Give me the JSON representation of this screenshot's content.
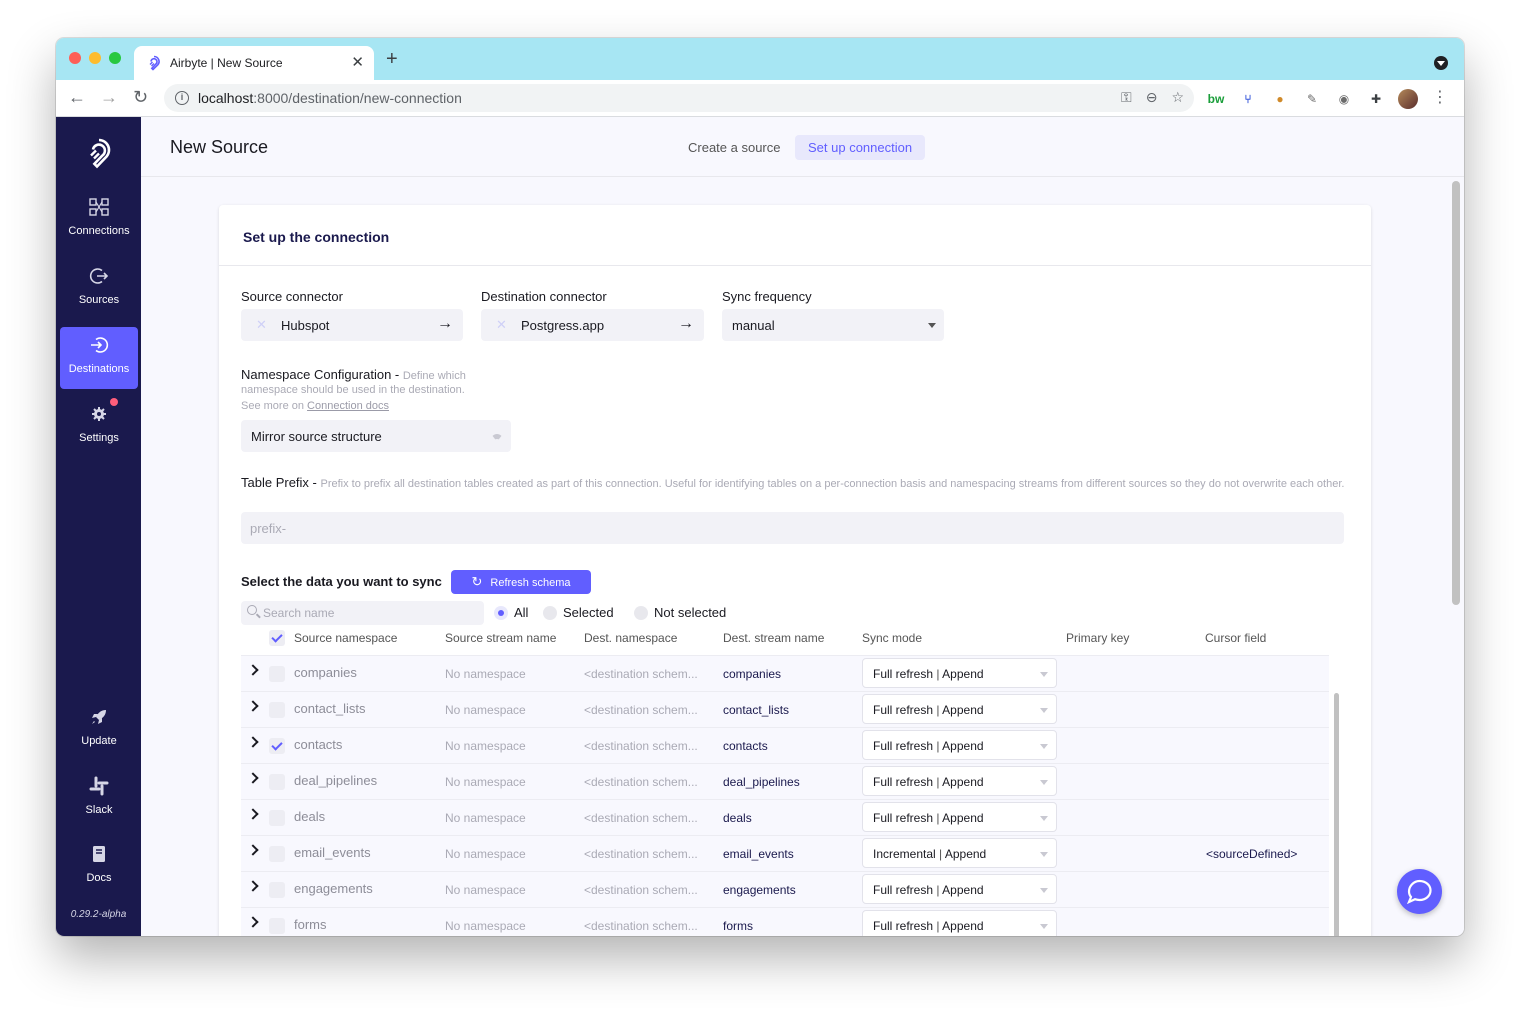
{
  "browser": {
    "tab_title": "Airbyte | New Source",
    "tab_close": "✕",
    "new_tab": "+",
    "url_host": "localhost",
    "url_path": ":8000/destination/new-connection",
    "ext_bw": "bw"
  },
  "sidebar": {
    "items": [
      {
        "label": "Connections",
        "icon": "connections-icon"
      },
      {
        "label": "Sources",
        "icon": "sources-icon"
      },
      {
        "label": "Destinations",
        "icon": "destinations-icon",
        "active": true
      },
      {
        "label": "Settings",
        "icon": "gear-icon"
      },
      {
        "label": "Update",
        "icon": "rocket-icon"
      },
      {
        "label": "Slack",
        "icon": "slack-icon"
      },
      {
        "label": "Docs",
        "icon": "book-icon"
      }
    ],
    "version": "0.29.2-alpha"
  },
  "header": {
    "title": "New Source",
    "steps": [
      "Create a source",
      "Set up connection"
    ],
    "active_step": 1
  },
  "card": {
    "title": "Set up the connection",
    "source_connector_label": "Source connector",
    "source_connector_value": "Hubspot",
    "destination_connector_label": "Destination connector",
    "destination_connector_value": "Postgress.app",
    "sync_frequency_label": "Sync frequency",
    "sync_frequency_value": "manual",
    "namespace": {
      "label": "Namespace Configuration - ",
      "hint_1": "Define which",
      "hint_2": "namespace should be used in the destination.",
      "hint_3": "See more on ",
      "link": "Connection docs",
      "value": "Mirror source structure"
    },
    "table_prefix": {
      "label": "Table Prefix - ",
      "hint": "Prefix to prefix all destination tables created as part of this connection. Useful for identifying tables on a per-connection basis and namespacing streams from different sources so they do not overwrite each other.",
      "placeholder": "prefix-"
    },
    "select_data_label": "Select the data you want to sync",
    "refresh_button": "Refresh schema",
    "search_placeholder": "Search name",
    "filters": [
      {
        "label": "All",
        "selected": true
      },
      {
        "label": "Selected",
        "selected": false
      },
      {
        "label": "Not selected",
        "selected": false
      }
    ],
    "columns": [
      "Source namespace",
      "Source stream name",
      "Dest. namespace",
      "Dest. stream name",
      "Sync mode",
      "Primary key",
      "Cursor field"
    ],
    "rows": [
      {
        "source": "companies",
        "ns": "No namespace",
        "dest_ns": "<destination schem...",
        "dest_stream": "companies",
        "sync_a": "Full refresh",
        "sync_b": "Append",
        "cursor": "",
        "checked": false
      },
      {
        "source": "contact_lists",
        "ns": "No namespace",
        "dest_ns": "<destination schem...",
        "dest_stream": "contact_lists",
        "sync_a": "Full refresh",
        "sync_b": "Append",
        "cursor": "",
        "checked": false
      },
      {
        "source": "contacts",
        "ns": "No namespace",
        "dest_ns": "<destination schem...",
        "dest_stream": "contacts",
        "sync_a": "Full refresh",
        "sync_b": "Append",
        "cursor": "",
        "checked": true
      },
      {
        "source": "deal_pipelines",
        "ns": "No namespace",
        "dest_ns": "<destination schem...",
        "dest_stream": "deal_pipelines",
        "sync_a": "Full refresh",
        "sync_b": "Append",
        "cursor": "",
        "checked": false
      },
      {
        "source": "deals",
        "ns": "No namespace",
        "dest_ns": "<destination schem...",
        "dest_stream": "deals",
        "sync_a": "Full refresh",
        "sync_b": "Append",
        "cursor": "",
        "checked": false
      },
      {
        "source": "email_events",
        "ns": "No namespace",
        "dest_ns": "<destination schem...",
        "dest_stream": "email_events",
        "sync_a": "Incremental",
        "sync_b": "Append",
        "cursor": "<sourceDefined>",
        "checked": false
      },
      {
        "source": "engagements",
        "ns": "No namespace",
        "dest_ns": "<destination schem...",
        "dest_stream": "engagements",
        "sync_a": "Full refresh",
        "sync_b": "Append",
        "cursor": "",
        "checked": false
      },
      {
        "source": "forms",
        "ns": "No namespace",
        "dest_ns": "<destination schem...",
        "dest_stream": "forms",
        "sync_a": "Full refresh",
        "sync_b": "Append",
        "cursor": "",
        "checked": false
      }
    ]
  },
  "colors": {
    "accent": "#615eff",
    "sidebar": "#1a194d",
    "tabbar": "#a7e6f3"
  }
}
